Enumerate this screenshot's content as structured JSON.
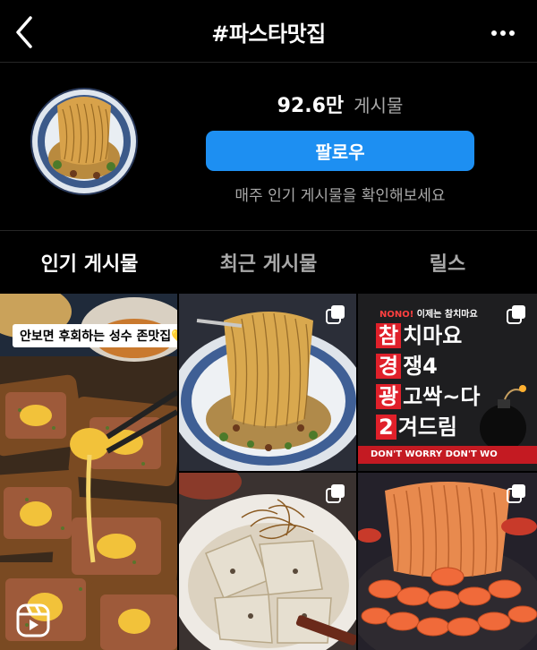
{
  "header": {
    "title": "#파스타맛집",
    "back_icon": "chevron-left-icon",
    "more_icon": "more-horizontal-icon"
  },
  "profile": {
    "post_count": "92.6만",
    "post_label": "게시물",
    "follow_label": "팔로우",
    "subtext": "매주 인기 게시물을 확인해보세요",
    "follow_color": "#1d8ff2"
  },
  "tabs": [
    {
      "label": "인기 게시물",
      "active": true
    },
    {
      "label": "최근 게시물",
      "active": false
    },
    {
      "label": "릴스",
      "active": false
    }
  ],
  "grid": {
    "post1": {
      "caption": "안보면 후회하는 성수 존맛집💛",
      "type": "reel"
    },
    "post2": {
      "type": "carousel"
    },
    "post3": {
      "type": "carousel",
      "top_red": "NONO!",
      "top_white": "이제는 참치마요",
      "lines": [
        {
          "red": "참",
          "white": "치마요"
        },
        {
          "red": "경",
          "white": "쟁4"
        },
        {
          "red": "광",
          "white": "고싹~다"
        },
        {
          "red": "2",
          "white": "겨드림"
        }
      ],
      "banner": "DON'T WORRY  DON'T WO"
    },
    "post4": {
      "type": "carousel"
    },
    "post5": {
      "type": "carousel"
    }
  }
}
